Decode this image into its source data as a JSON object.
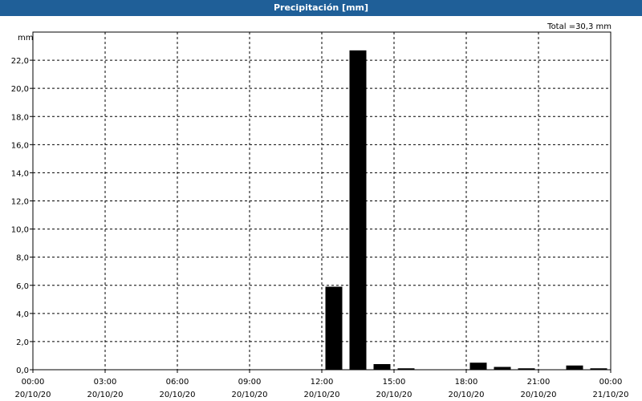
{
  "window": {
    "title": "Precipitación [mm]"
  },
  "chart_data": {
    "type": "bar",
    "title": "Precipitación [mm]",
    "ylabel": "mm",
    "xlabel": "",
    "annotation": "Total =30,3 mm",
    "ylim": [
      0,
      24
    ],
    "yticks": [
      "0,0",
      "2,0",
      "4,0",
      "6,0",
      "8,0",
      "10,0",
      "12,0",
      "14,0",
      "16,0",
      "18,0",
      "20,0",
      "22,0"
    ],
    "xticks": [
      {
        "time": "00:00",
        "date": "20/10/20"
      },
      {
        "time": "03:00",
        "date": "20/10/20"
      },
      {
        "time": "06:00",
        "date": "20/10/20"
      },
      {
        "time": "09:00",
        "date": "20/10/20"
      },
      {
        "time": "12:00",
        "date": "20/10/20"
      },
      {
        "time": "15:00",
        "date": "20/10/20"
      },
      {
        "time": "18:00",
        "date": "20/10/20"
      },
      {
        "time": "21:00",
        "date": "20/10/20"
      },
      {
        "time": "00:00",
        "date": "21/10/20"
      }
    ],
    "x_range_hours": [
      0,
      24
    ],
    "grid": true,
    "bar_color": "#000000",
    "bars": [
      {
        "time": "12:00",
        "hour": 12,
        "value": 5.9
      },
      {
        "time": "13:00",
        "hour": 13,
        "value": 22.7
      },
      {
        "time": "14:00",
        "hour": 14,
        "value": 0.4
      },
      {
        "time": "15:00",
        "hour": 15,
        "value": 0.1
      },
      {
        "time": "18:00",
        "hour": 18,
        "value": 0.5
      },
      {
        "time": "19:00",
        "hour": 19,
        "value": 0.2
      },
      {
        "time": "20:00",
        "hour": 20,
        "value": 0.1
      },
      {
        "time": "22:00",
        "hour": 22,
        "value": 0.3
      },
      {
        "time": "23:00",
        "hour": 23,
        "value": 0.1
      }
    ]
  }
}
